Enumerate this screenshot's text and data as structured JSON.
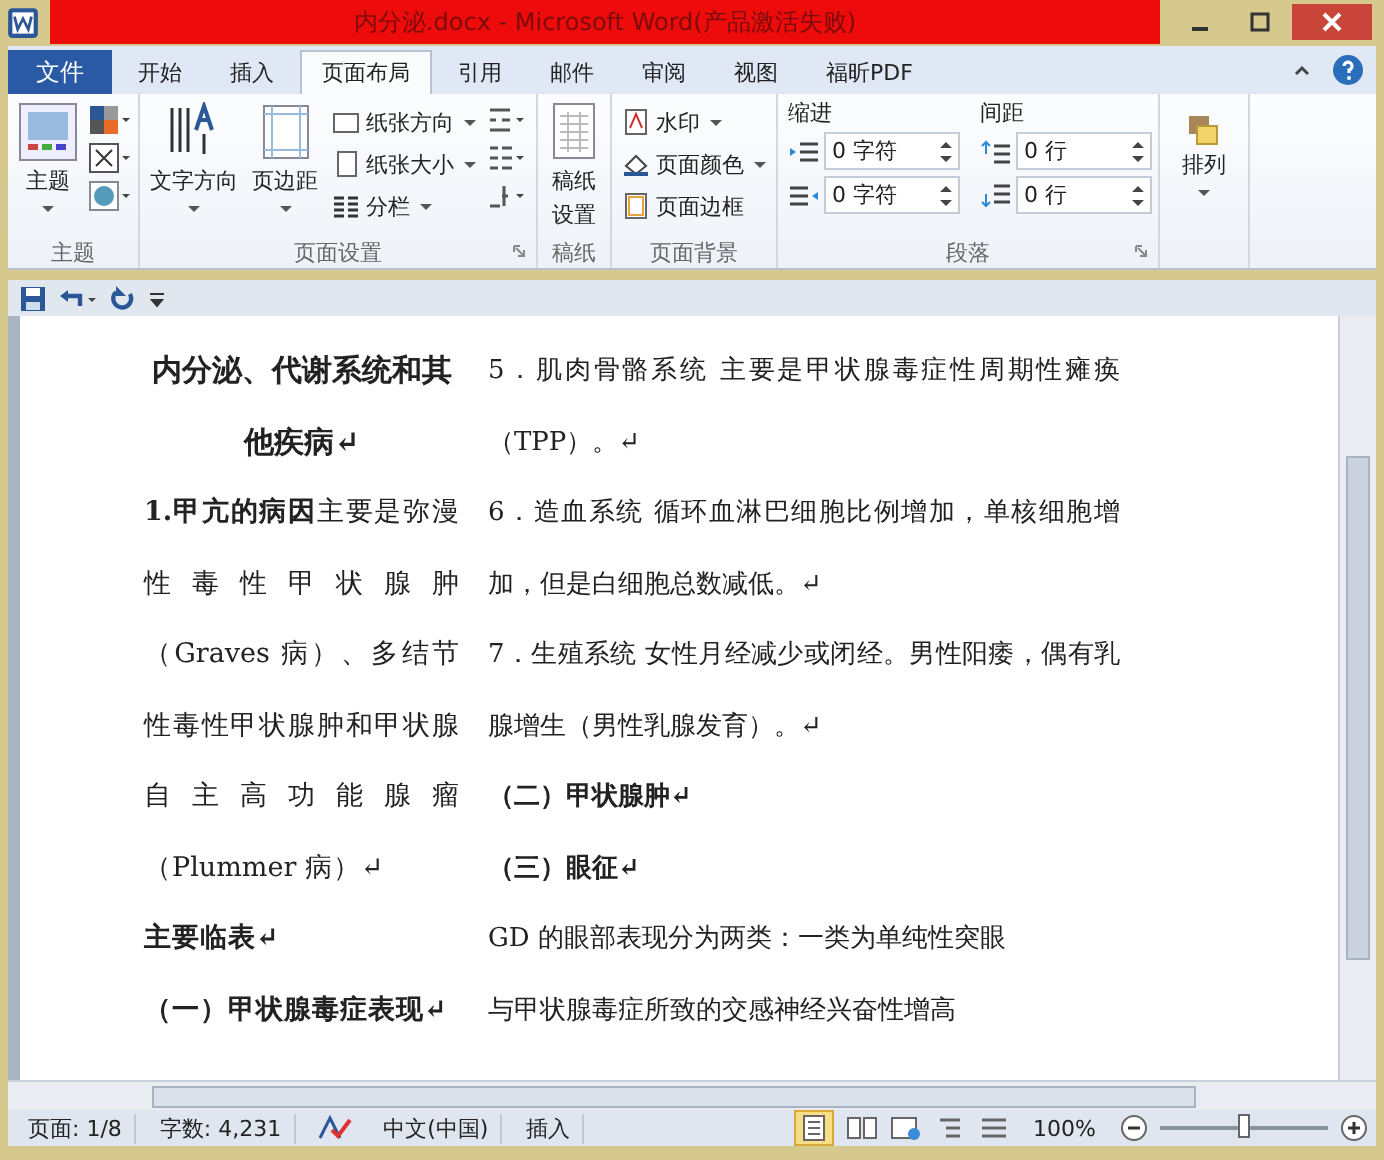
{
  "window": {
    "title": "内分泌.docx - Microsoft Word(产品激活失败)"
  },
  "tabs": [
    {
      "label": "文件",
      "kind": "file",
      "selected": false
    },
    {
      "label": "开始",
      "kind": "tab",
      "selected": false
    },
    {
      "label": "插入",
      "kind": "tab",
      "selected": false
    },
    {
      "label": "页面布局",
      "kind": "tab",
      "selected": true
    },
    {
      "label": "引用",
      "kind": "tab",
      "selected": false
    },
    {
      "label": "邮件",
      "kind": "tab",
      "selected": false
    },
    {
      "label": "审阅",
      "kind": "tab",
      "selected": false
    },
    {
      "label": "视图",
      "kind": "tab",
      "selected": false
    },
    {
      "label": "福昕PDF",
      "kind": "tab",
      "selected": false
    }
  ],
  "ribbon": {
    "themes": {
      "label": "主题",
      "button": "主题"
    },
    "page_setup": {
      "label": "页面设置",
      "text_direction": "文字方向",
      "margins": "页边距",
      "orientation": "纸张方向",
      "size": "纸张大小",
      "columns": "分栏"
    },
    "manuscript": {
      "label": "稿纸",
      "button": "稿纸设置"
    },
    "background": {
      "label": "页面背景",
      "watermark": "水印",
      "page_color": "页面颜色",
      "page_borders": "页面边框"
    },
    "paragraph": {
      "label": "段落",
      "indent_label": "缩进",
      "indent_left": "0 字符",
      "indent_right": "0 字符",
      "spacing_label": "间距",
      "spacing_before": "0 行",
      "spacing_after": "0 行"
    },
    "arrange": {
      "button": "排列"
    }
  },
  "document": {
    "left": [
      {
        "kind": "title",
        "text": "内分泌、代谢系统和其他疾病↵"
      },
      {
        "kind": "body",
        "text": "**1.甲亢的病因**主要是弥漫性毒性甲状腺肿（Graves 病）、多结节性毒性甲状腺肿和甲状腺自主高功能腺瘤（Plummer 病）↵"
      },
      {
        "kind": "heading",
        "text": "主要临表↵"
      },
      {
        "kind": "heading",
        "text": "（一）甲状腺毒症表现↵"
      }
    ],
    "right": [
      {
        "kind": "body",
        "text": "5．肌肉骨骼系统 主要是甲状腺毒症性周期性瘫痪（TPP）。↵"
      },
      {
        "kind": "body",
        "text": "6．造血系统 循环血淋巴细胞比例增加，单核细胞增加，但是白细胞总数减低。↵"
      },
      {
        "kind": "body",
        "text": "7．生殖系统 女性月经减少或闭经。男性阳痿，偶有乳腺增生（男性乳腺发育）。↵"
      },
      {
        "kind": "heading",
        "text": "（二）甲状腺肿↵"
      },
      {
        "kind": "heading",
        "text": "（三）眼征↵"
      },
      {
        "kind": "body",
        "text": "GD 的眼部表现分为两类：一类为单纯性突眼"
      },
      {
        "kind": "body",
        "text": "与甲状腺毒症所致的交感神经兴奋性增高"
      }
    ]
  },
  "status_bar": {
    "page": "页面: 1/8",
    "words": "字数: 4,231",
    "language": "中文(中国)",
    "mode": "插入",
    "zoom": "100%",
    "zoom_slider": {
      "level": 0.5
    }
  }
}
